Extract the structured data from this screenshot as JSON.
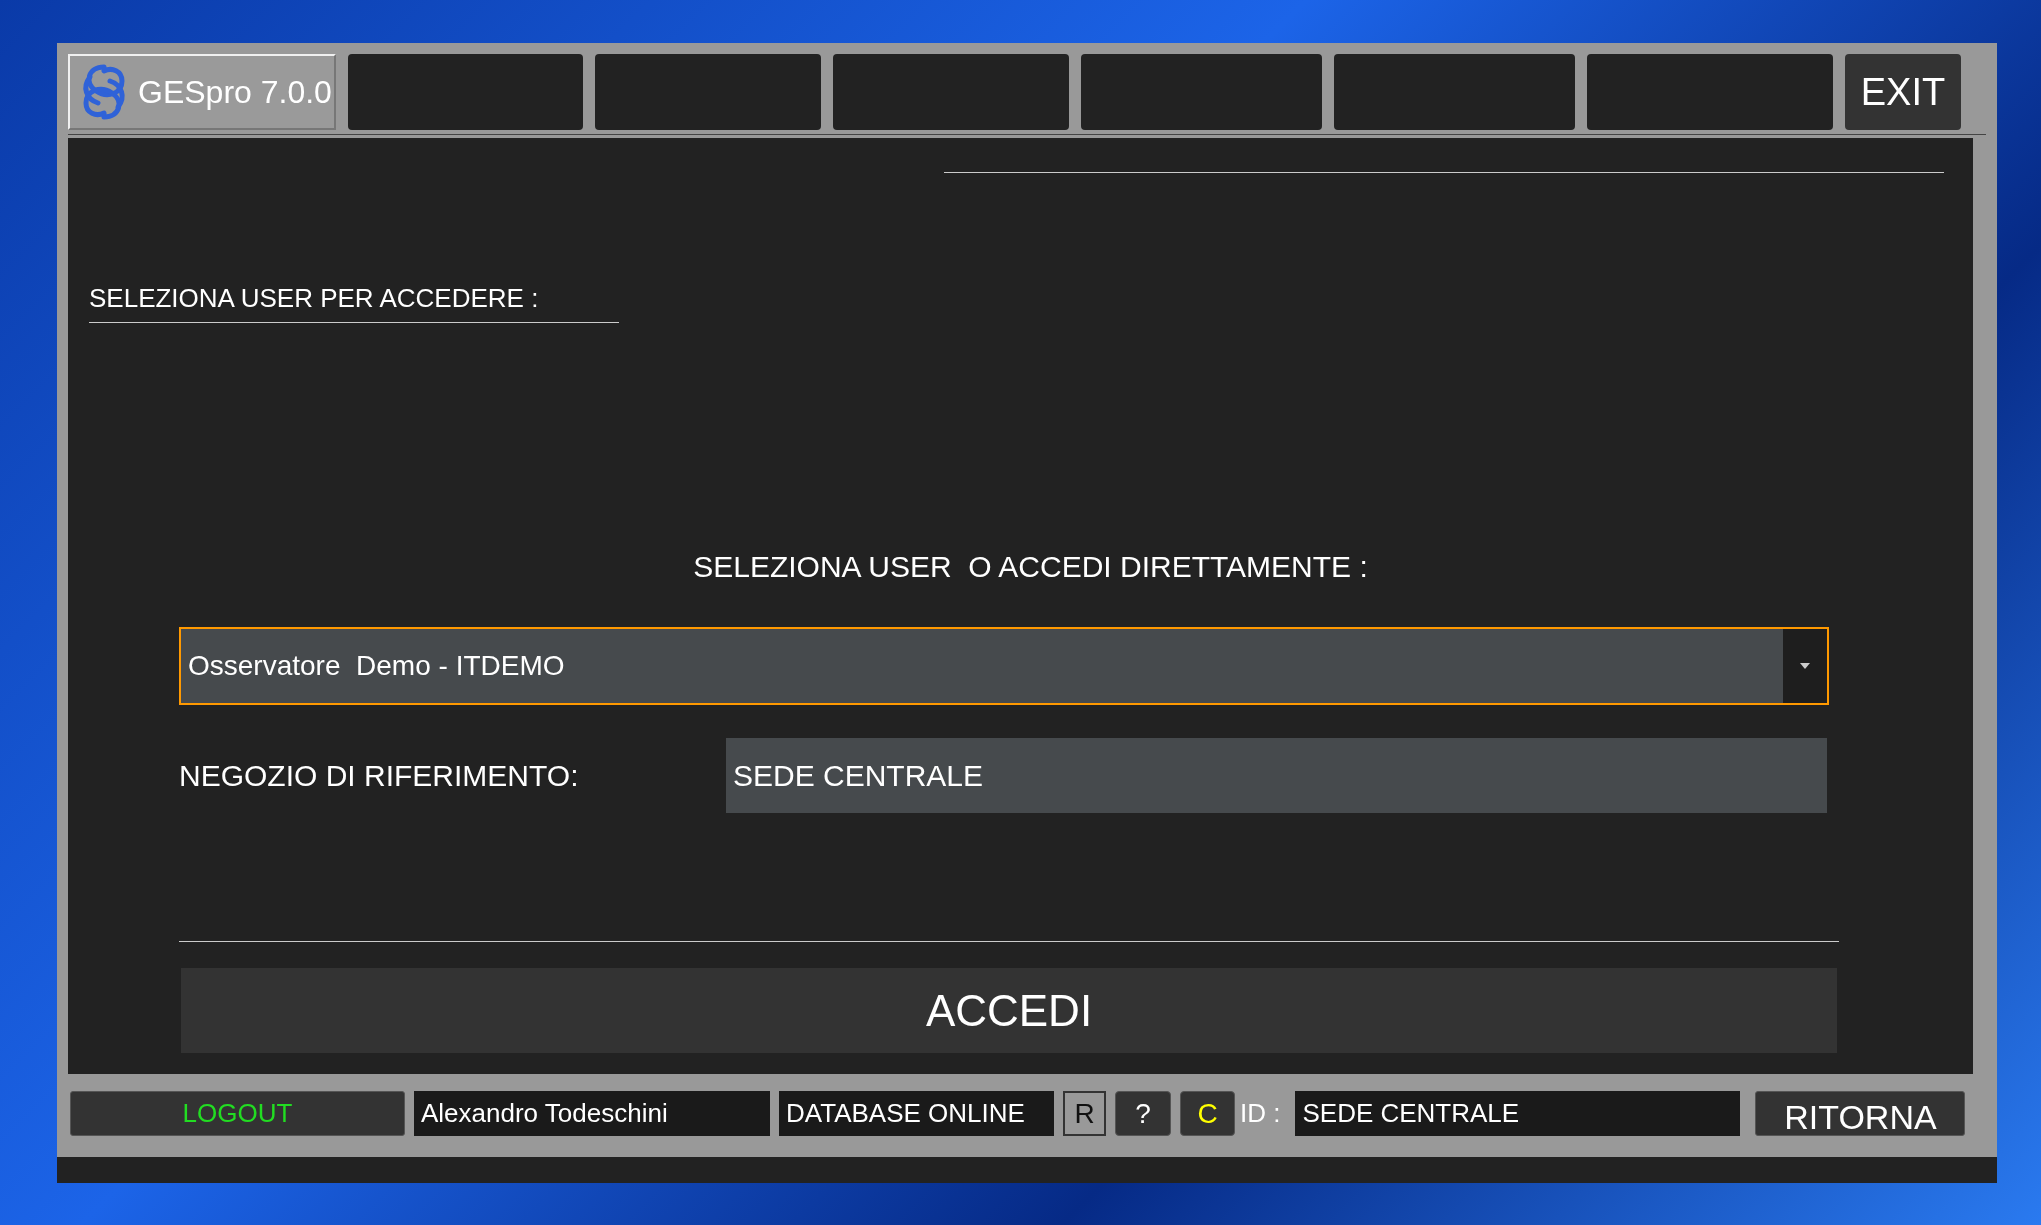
{
  "app": {
    "title": "GESpro 7.0.0",
    "exit": "EXIT"
  },
  "login": {
    "section_label": "SELEZIONA USER PER ACCEDERE :",
    "prompt": "SELEZIONA USER  O ACCEDI DIRETTAMENTE :",
    "user_select": {
      "value": "Osservatore  Demo - ITDEMO",
      "focused": true
    },
    "store_label": "NEGOZIO DI RIFERIMENTO:",
    "store_value": "SEDE CENTRALE",
    "submit": "ACCEDI"
  },
  "status_bar": {
    "logout": "LOGOUT",
    "user": "Alexandro Todeschini",
    "database": "DATABASE ONLINE",
    "buttons": [
      {
        "label": "R",
        "kind": "outlined"
      },
      {
        "label": "?",
        "kind": "plain"
      },
      {
        "label": "C",
        "kind": "highlight"
      }
    ],
    "id_label": "ID :",
    "id_value": "SEDE CENTRALE",
    "back": "RITORNA"
  }
}
